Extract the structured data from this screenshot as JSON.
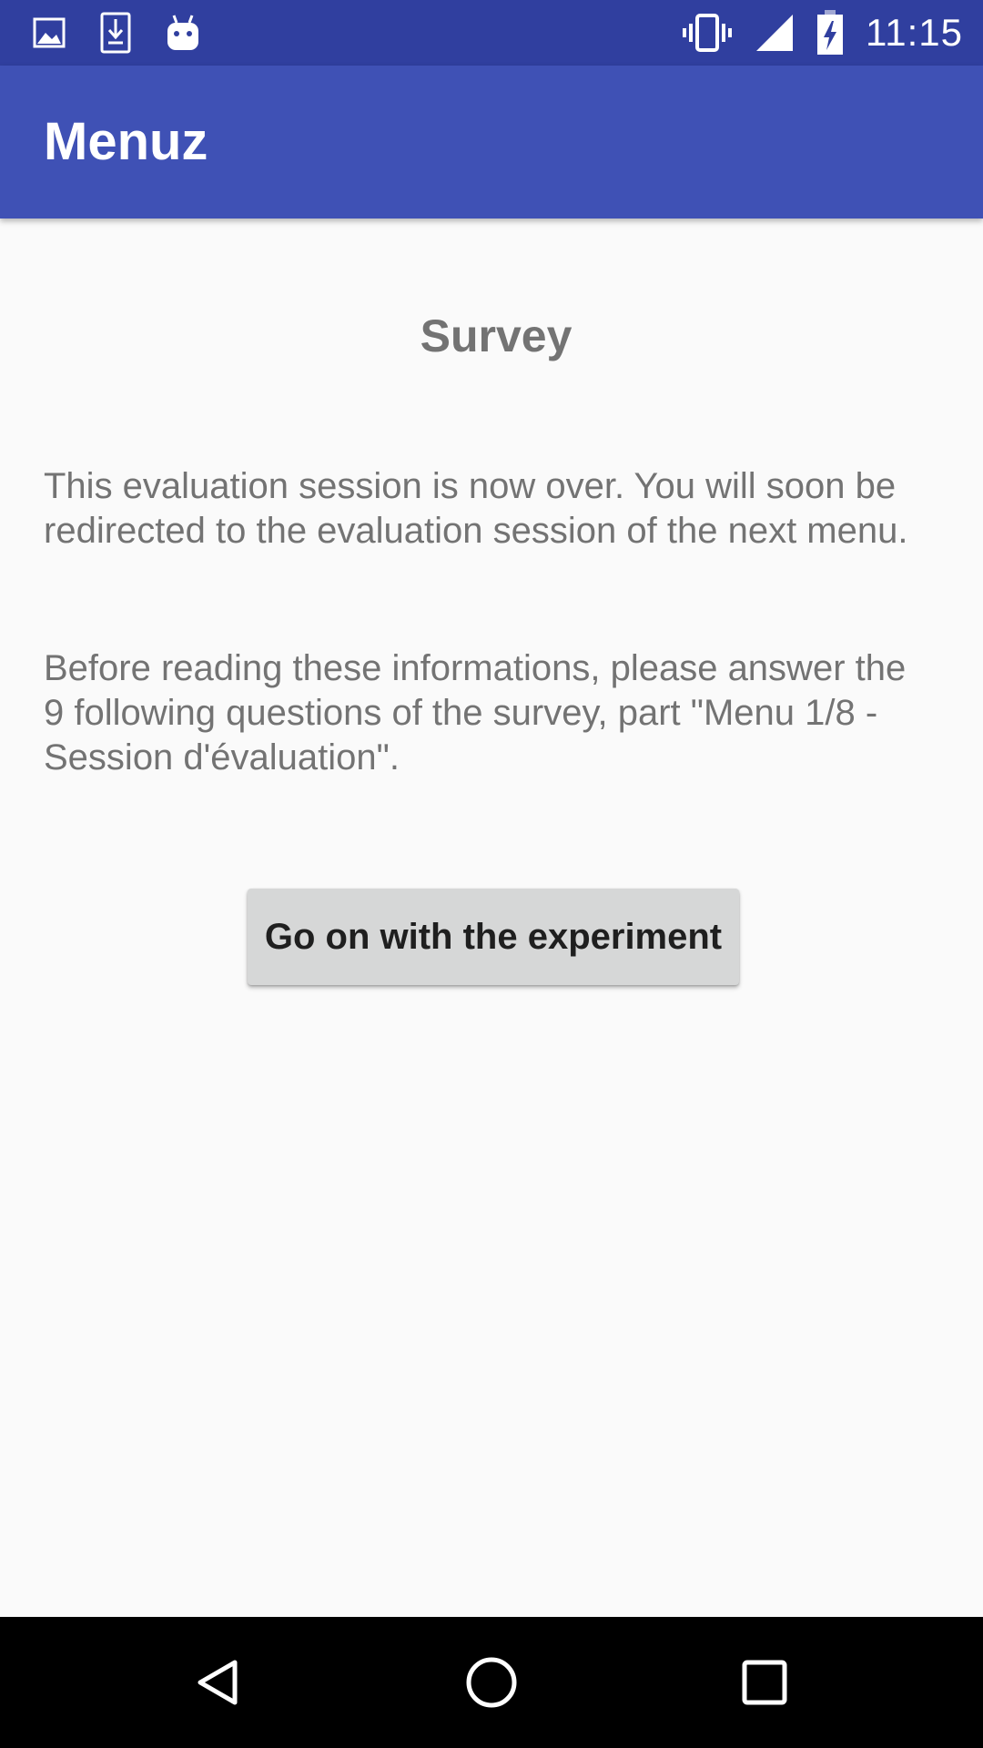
{
  "status_bar": {
    "time": "11:15",
    "left_icons": [
      "image-icon",
      "download-icon",
      "android-icon"
    ],
    "right_icons": [
      "vibrate-icon",
      "signal-icon",
      "battery-charging-icon"
    ]
  },
  "app_bar": {
    "title": "Menuz"
  },
  "content": {
    "title": "Survey",
    "paragraph_1": "This evaluation session is now over. You will soon be redirected to the evaluation session of the next menu.",
    "paragraph_2": "Before reading these informations, please answer the 9 following questions of the survey, part \"Menu 1/8 - Session d'évaluation\".",
    "button_label": "Go on with the experiment"
  },
  "nav_bar": {
    "icons": [
      "back-icon",
      "home-icon",
      "recents-icon"
    ]
  },
  "colors": {
    "status_bar": "#303f9f",
    "app_bar": "#3f51b5",
    "background": "#fafafa",
    "body_text": "#737373",
    "button": "#d6d7d7"
  }
}
